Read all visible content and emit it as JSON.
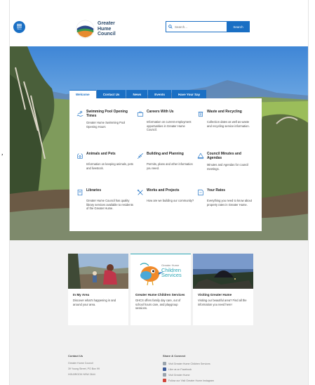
{
  "page": {
    "stray_mark": ","
  },
  "header": {
    "menu_label": "Menu",
    "logo_lines": [
      "Greater",
      "Hume",
      "Council"
    ],
    "search_placeholder": "Search...",
    "search_button": "Search"
  },
  "tabs": [
    {
      "label": "Welcome",
      "active": true
    },
    {
      "label": "Contact Us",
      "active": false
    },
    {
      "label": "News",
      "active": false
    },
    {
      "label": "Events",
      "active": false
    },
    {
      "label": "Have Your Say",
      "active": false
    }
  ],
  "tiles": [
    {
      "icon": "swimmer-icon",
      "title": "Swimming Pool Opening Times",
      "desc": "Greater Hume Swimming Pool Opening Hours"
    },
    {
      "icon": "briefcase-icon",
      "title": "Careers With Us",
      "desc": "Information on current employment opportunities in Greater Hume Council."
    },
    {
      "icon": "bin-icon",
      "title": "Waste and Recycling",
      "desc": "Collection dates as well as waste and recycling service information."
    },
    {
      "icon": "paw-icon",
      "title": "Animals and Pets",
      "desc": "Information on keeping animals, pets and livestock."
    },
    {
      "icon": "building-icon",
      "title": "Building and Planning",
      "desc": "Permits, plans and other information you need."
    },
    {
      "icon": "gavel-icon",
      "title": "Council Minutes and Agendas",
      "desc": "Minutes and Agendas for council meetings."
    },
    {
      "icon": "book-icon",
      "title": "Libraries",
      "desc": "Greater Hume Council has quality library services available to residents of the Greater Hume."
    },
    {
      "icon": "tools-icon",
      "title": "Works and Projects",
      "desc": "How are we building our community?"
    },
    {
      "icon": "rates-icon",
      "title": "Your Rates",
      "desc": "Everything you need to know about property rates in Greater Hume."
    }
  ],
  "cards": [
    {
      "title": "In My Area",
      "desc": "Discover what's happening in and around your area."
    },
    {
      "title": "Greater Hume Children Services",
      "desc": "GHCS offers family day care, out of school hours care, and playgroup sessions.",
      "logo_small": "Greater Hume",
      "logo_big": [
        "Children",
        "Services"
      ]
    },
    {
      "title": "Visiting Greater Hume",
      "desc": "Visiting our beautiful area? Find all the information you need here!"
    }
  ],
  "footer": {
    "contact_heading": "Contact Us",
    "contact_lines": [
      "Greater Hume Council",
      "39 Young Street, PO Box 99",
      "HOLBROOK NSW 2644"
    ],
    "share_heading": "Share & Connect",
    "links": [
      {
        "icon": "link-icon",
        "label": "Visit Greater Hume Children Services"
      },
      {
        "icon": "facebook-icon",
        "label": "Like us on Facebook"
      },
      {
        "icon": "link-icon",
        "label": "Visit Greater Hume"
      },
      {
        "icon": "youtube-icon",
        "label": "Follow our Visit Greater Hume Instagram"
      }
    ]
  },
  "colors": {
    "accent": "#1a6fc4",
    "text": "#222222",
    "muted": "#f1f1f1"
  }
}
